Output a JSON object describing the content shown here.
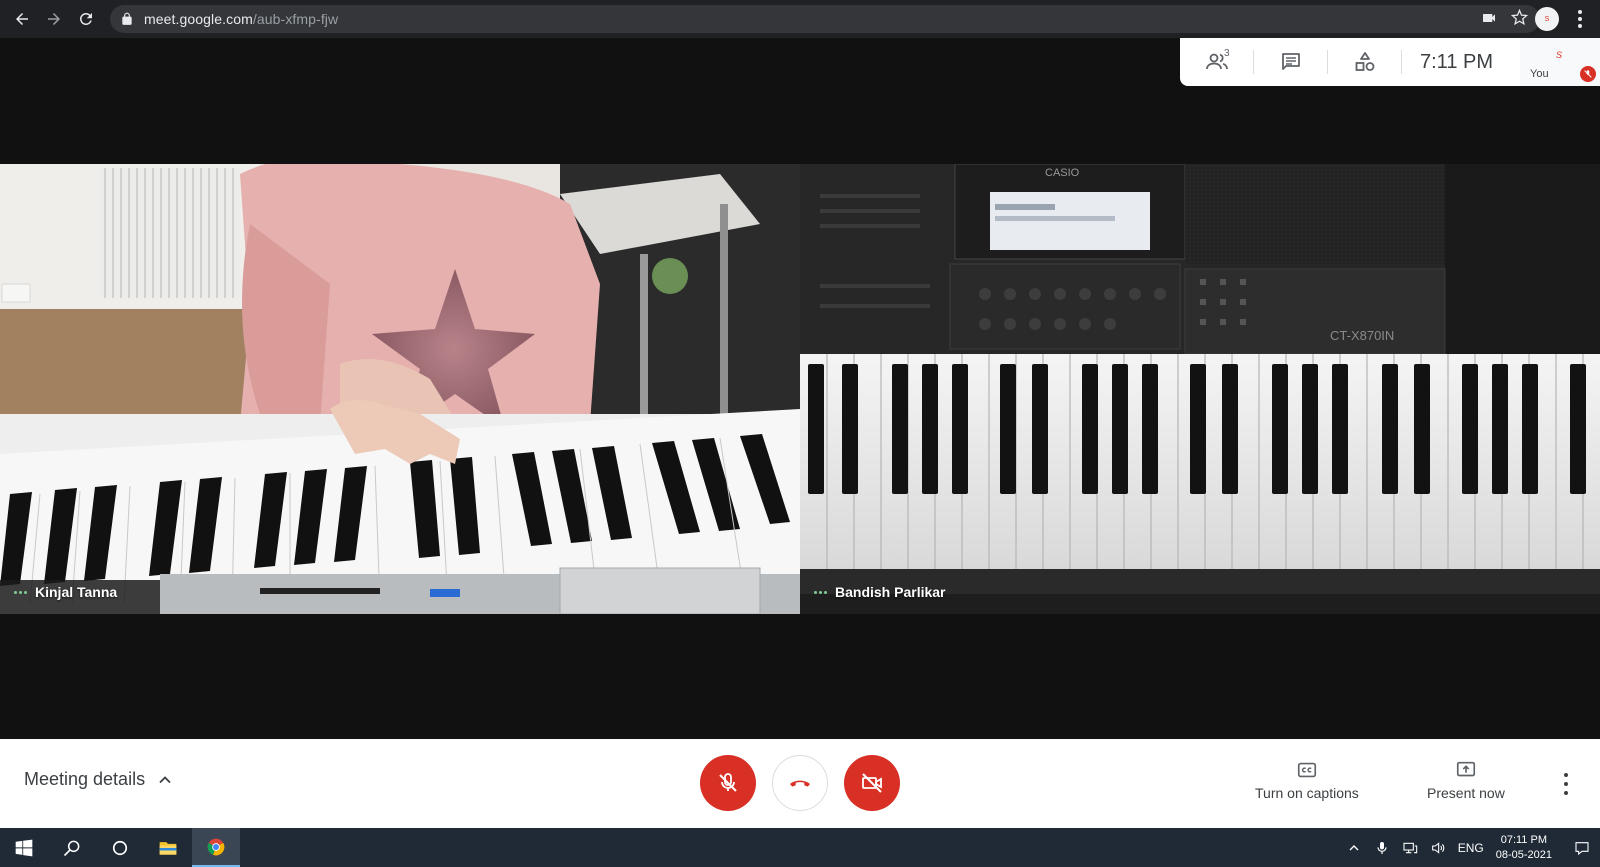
{
  "browser": {
    "url_host": "meet.google.com",
    "url_path": "/aub-xfmp-fjw"
  },
  "top_panel": {
    "participant_count": "3",
    "time": "7:11 PM",
    "self_label": "You"
  },
  "tiles": [
    {
      "name": "Kinjal Tanna"
    },
    {
      "name": "Bandish Parlikar",
      "keyboard_brand": "CASIO",
      "keyboard_model": "CT-X870IN"
    }
  ],
  "bottom_bar": {
    "meeting_details": "Meeting details",
    "captions": "Turn on captions",
    "present": "Present now"
  },
  "taskbar": {
    "language": "ENG",
    "time": "07:11 PM",
    "date": "08-05-2021"
  },
  "colors": {
    "stage_bg": "#111111",
    "danger": "#d93025",
    "speaking_dots": "#81c995"
  },
  "icons": [
    "back-arrow-icon",
    "forward-arrow-icon",
    "reload-icon",
    "lock-icon",
    "camera-blocked-icon",
    "star-icon",
    "people-icon",
    "chat-icon",
    "activities-icon",
    "mic-off-icon",
    "hang-up-icon",
    "camera-off-icon",
    "captions-icon",
    "present-icon",
    "windows-start-icon",
    "search-icon",
    "task-view-icon",
    "file-explorer-icon",
    "chrome-icon"
  ]
}
